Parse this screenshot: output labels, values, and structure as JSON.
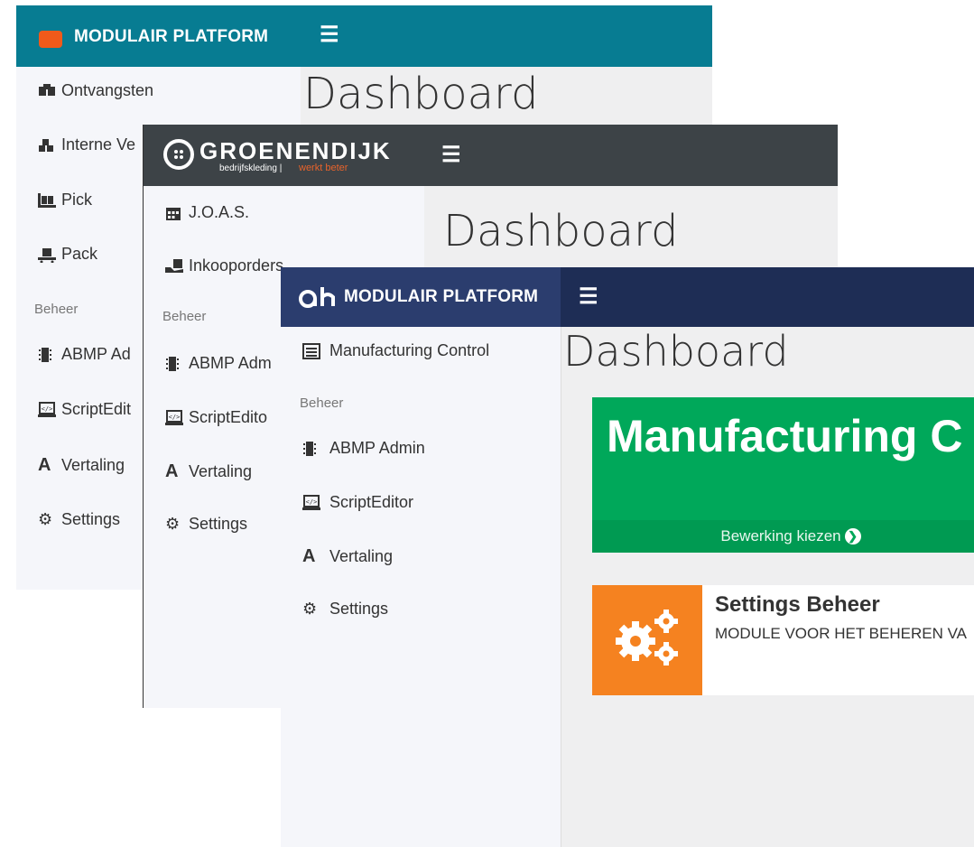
{
  "window_back": {
    "brand": "MODULAIR PLATFORM",
    "brand_color": "#077c92",
    "page_title": "Dashboard",
    "nav": [
      {
        "label": "Ontvangsten",
        "icon": "boxes-icon"
      },
      {
        "label": "Interne Ve",
        "icon": "cubes-icon"
      },
      {
        "label": "Pick",
        "icon": "pallet-icon"
      },
      {
        "label": "Pack",
        "icon": "dolly-icon"
      }
    ],
    "section": "Beheer",
    "admin_nav": [
      {
        "label": "ABMP Ad",
        "icon": "chip-icon"
      },
      {
        "label": "ScriptEdit",
        "icon": "monitor-code-icon"
      },
      {
        "label": "Vertaling",
        "icon": "translate-a-icon"
      },
      {
        "label": "Settings",
        "icon": "gears-icon"
      }
    ]
  },
  "window_middle": {
    "logo_main": "GROENENDIJK",
    "logo_sub_left": "bedrijfskleding |",
    "logo_sub_right": "werkt beter",
    "brand_color": "#3d4347",
    "page_title": "Dashboard",
    "nav": [
      {
        "label": "J.O.A.S.",
        "icon": "calendar-icon"
      },
      {
        "label": "Inkooporders",
        "icon": "hand-box-icon"
      }
    ],
    "section": "Beheer",
    "admin_nav": [
      {
        "label": "ABMP Adm",
        "icon": "chip-icon"
      },
      {
        "label": "ScriptEdito",
        "icon": "monitor-code-icon"
      },
      {
        "label": "Vertaling",
        "icon": "translate-a-icon"
      },
      {
        "label": "Settings",
        "icon": "gears-icon"
      }
    ]
  },
  "window_front": {
    "brand": "MODULAIR PLATFORM",
    "brand_color": "#1e2d55",
    "page_title": "Dashboard",
    "nav": [
      {
        "label": "Manufacturing Control",
        "icon": "list-icon"
      }
    ],
    "section": "Beheer",
    "admin_nav": [
      {
        "label": "ABMP Admin",
        "icon": "chip-icon"
      },
      {
        "label": "ScriptEditor",
        "icon": "monitor-code-icon"
      },
      {
        "label": "Vertaling",
        "icon": "translate-a-icon"
      },
      {
        "label": "Settings",
        "icon": "gears-icon"
      }
    ],
    "tile_main": {
      "title": "Manufacturing C",
      "link": "Bewerking kiezen",
      "color": "#00a85a"
    },
    "tile_settings": {
      "title": "Settings Beheer",
      "description": "MODULE VOOR HET BEHEREN VA",
      "color": "#f58220"
    }
  }
}
